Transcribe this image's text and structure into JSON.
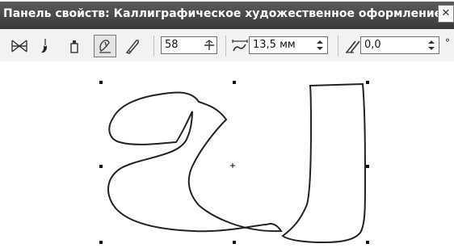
{
  "panel": {
    "title": "Панель свойств: Каллиграфическое художественное оформление"
  },
  "toolbar": {
    "tools": [
      {
        "icon": "preset-icon"
      },
      {
        "icon": "brush-icon"
      },
      {
        "icon": "sprayer-icon"
      },
      {
        "icon": "calligraphic-icon",
        "active": true
      },
      {
        "icon": "pressure-icon"
      }
    ],
    "smoothing_value": "58",
    "width_value": "13,5 мм",
    "angle_value": "0,0",
    "angle_unit": "°"
  }
}
